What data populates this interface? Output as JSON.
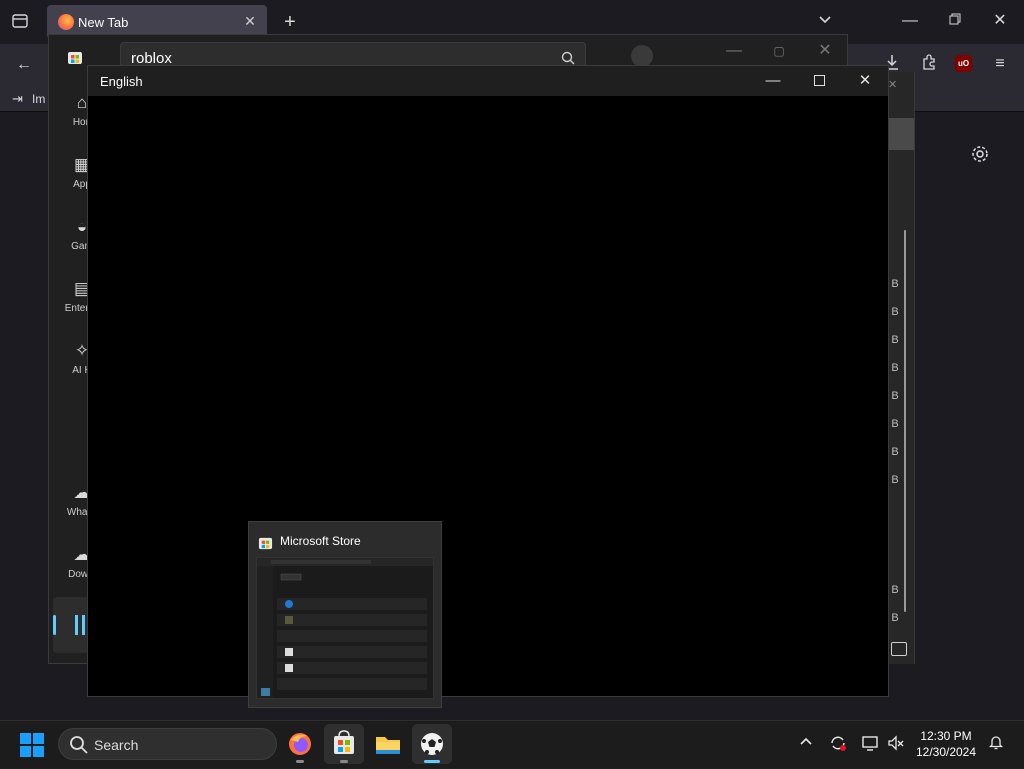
{
  "browser": {
    "tab_title": "New Tab",
    "bookmark_import": "Im"
  },
  "store": {
    "search_value": "roblox",
    "nav": [
      {
        "label": "Hon",
        "icon": "home-icon"
      },
      {
        "label": "App",
        "icon": "apps-icon"
      },
      {
        "label": "Gam",
        "icon": "gaming-icon"
      },
      {
        "label": "Entertai",
        "icon": "entertainment-icon"
      },
      {
        "label": "AI H",
        "icon": "ai-hub-icon"
      },
      {
        "label": "What's",
        "icon": "whats-new-icon"
      },
      {
        "label": "Downl",
        "icon": "downloads-icon"
      }
    ],
    "size_labels": [
      "B",
      "B",
      "B",
      "B",
      "B",
      "B",
      "B",
      "B",
      "B",
      "B"
    ]
  },
  "language_window": {
    "title": "English"
  },
  "taskbar_preview": {
    "title": "Microsoft Store"
  },
  "taskbar": {
    "search_label": "Search",
    "time": "12:30 PM",
    "date": "12/30/2024"
  },
  "colors": {
    "accent": "#60cdff",
    "windows_blue": "#1a9fff"
  }
}
